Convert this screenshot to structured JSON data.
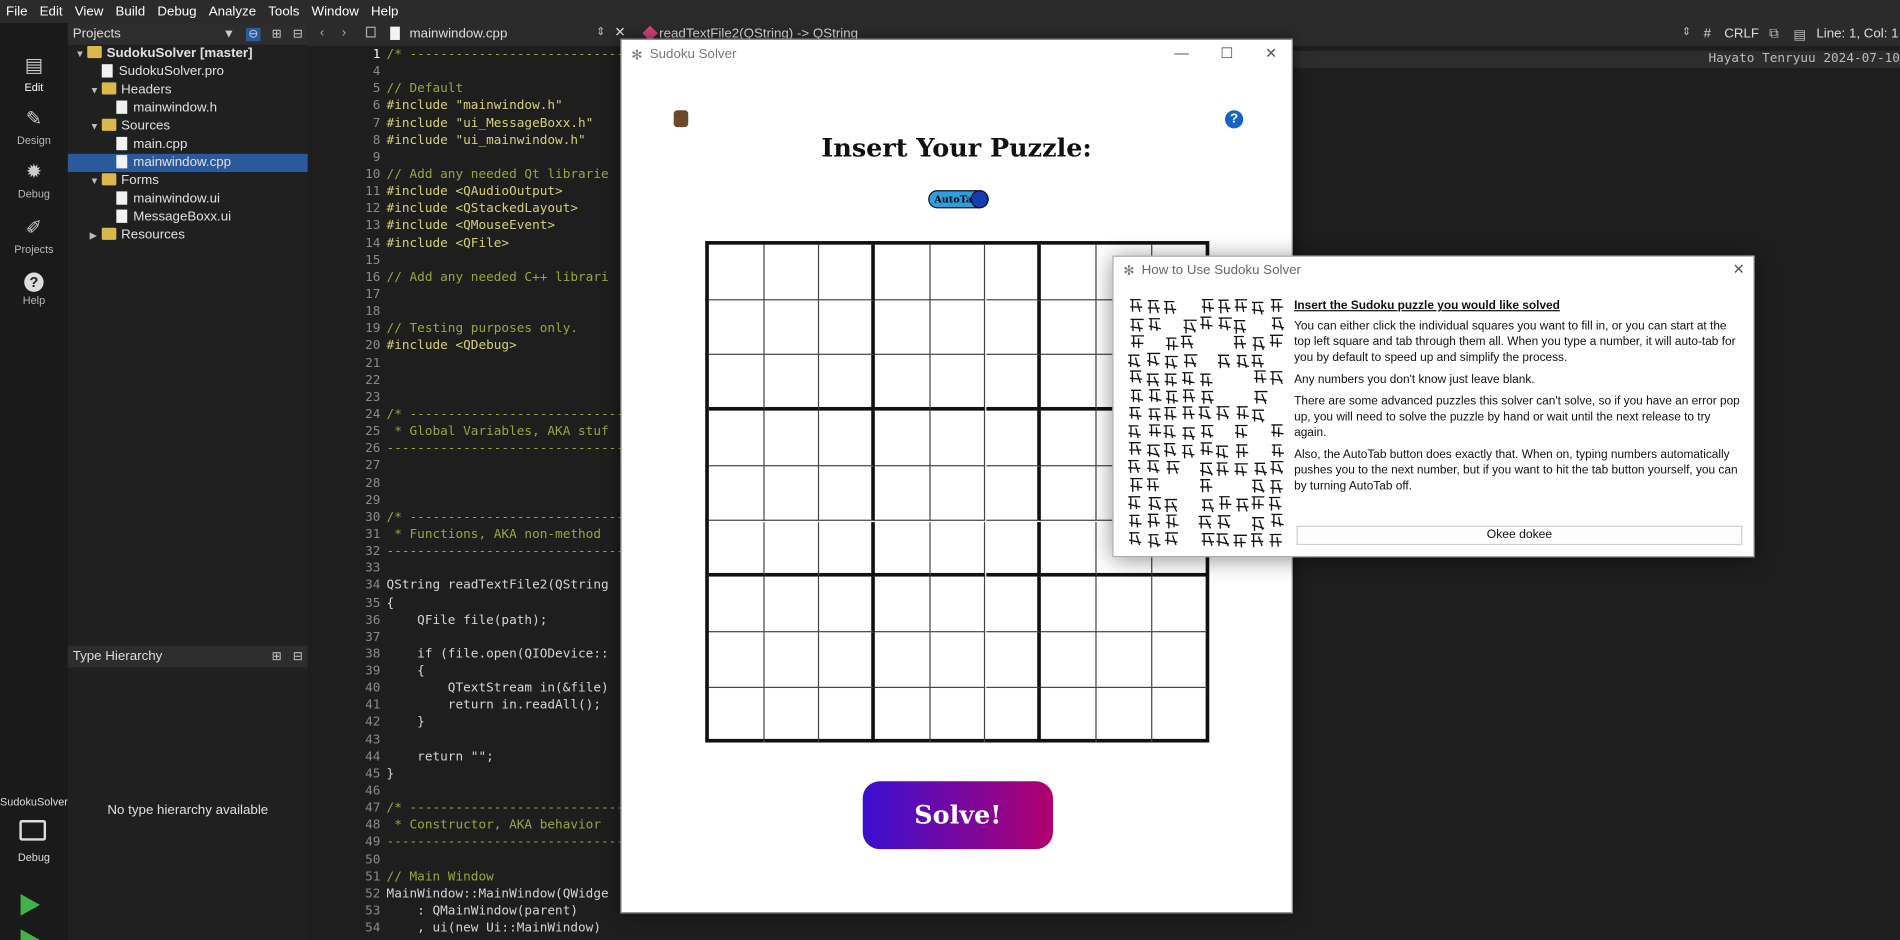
{
  "menu": [
    "File",
    "Edit",
    "View",
    "Build",
    "Debug",
    "Analyze",
    "Tools",
    "Window",
    "Help"
  ],
  "modes": [
    {
      "label": "Edit",
      "icon": "edit-icon"
    },
    {
      "label": "Design",
      "icon": "pencil-icon"
    },
    {
      "label": "Debug",
      "icon": "bug-icon"
    },
    {
      "label": "Projects",
      "icon": "wrench-icon"
    },
    {
      "label": "Help",
      "icon": "help-icon"
    }
  ],
  "kit": {
    "target": "SudokuSolver",
    "config": "Debug"
  },
  "projects": {
    "title": "Projects",
    "items": [
      {
        "label": "SudokuSolver [master]",
        "kind": "project",
        "depth": 0
      },
      {
        "label": "SudokuSolver.pro",
        "kind": "file",
        "depth": 1
      },
      {
        "label": "Headers",
        "kind": "folder",
        "depth": 1
      },
      {
        "label": "mainwindow.h",
        "kind": "file",
        "depth": 2
      },
      {
        "label": "Sources",
        "kind": "folder",
        "depth": 1
      },
      {
        "label": "main.cpp",
        "kind": "file",
        "depth": 2
      },
      {
        "label": "mainwindow.cpp",
        "kind": "file",
        "depth": 2,
        "selected": true
      },
      {
        "label": "Forms",
        "kind": "folder",
        "depth": 1
      },
      {
        "label": "mainwindow.ui",
        "kind": "file",
        "depth": 2
      },
      {
        "label": "MessageBoxx.ui",
        "kind": "file",
        "depth": 2
      },
      {
        "label": "Resources",
        "kind": "folder",
        "depth": 1
      }
    ]
  },
  "type_hierarchy": {
    "title": "Type Hierarchy",
    "empty": "No type hierarchy available"
  },
  "editor": {
    "file": "mainwindow.cpp",
    "symbol": "readTextFile2(QString) -> QString",
    "line_ending": "CRLF",
    "hash": "#",
    "position": "Line: 1, Col: 1",
    "author": "Hayato Tenryuu 2024-07-10",
    "lines": [
      {
        "n": "1",
        "t": "/* -----------------------------"
      },
      {
        "n": "4",
        "t": ""
      },
      {
        "n": "5",
        "t": "// Default"
      },
      {
        "n": "6",
        "t": "#include \"mainwindow.h\""
      },
      {
        "n": "7",
        "t": "#include \"ui_MessageBoxx.h\""
      },
      {
        "n": "8",
        "t": "#include \"ui_mainwindow.h\""
      },
      {
        "n": "9",
        "t": ""
      },
      {
        "n": "10",
        "t": "// Add any needed Qt librarie"
      },
      {
        "n": "11",
        "t": "#include <QAudioOutput>"
      },
      {
        "n": "12",
        "t": "#include <QStackedLayout>"
      },
      {
        "n": "13",
        "t": "#include <QMouseEvent>"
      },
      {
        "n": "14",
        "t": "#include <QFile>"
      },
      {
        "n": "15",
        "t": ""
      },
      {
        "n": "16",
        "t": "// Add any needed C++ librari"
      },
      {
        "n": "17",
        "t": ""
      },
      {
        "n": "18",
        "t": ""
      },
      {
        "n": "19",
        "t": "// Testing purposes only."
      },
      {
        "n": "20",
        "t": "#include <QDebug>"
      },
      {
        "n": "21",
        "t": ""
      },
      {
        "n": "22",
        "t": ""
      },
      {
        "n": "23",
        "t": ""
      },
      {
        "n": "24",
        "t": "/* -----------------------------"
      },
      {
        "n": "25",
        "t": " * Global Variables, AKA stuf"
      },
      {
        "n": "26",
        "t": "-------------------------------"
      },
      {
        "n": "27",
        "t": ""
      },
      {
        "n": "28",
        "t": ""
      },
      {
        "n": "29",
        "t": ""
      },
      {
        "n": "30",
        "t": "/* -----------------------------"
      },
      {
        "n": "31",
        "t": " * Functions, AKA non-method"
      },
      {
        "n": "32",
        "t": "-------------------------------"
      },
      {
        "n": "33",
        "t": ""
      },
      {
        "n": "34",
        "t": "QString readTextFile2(QString"
      },
      {
        "n": "35",
        "t": "{"
      },
      {
        "n": "36",
        "t": "    QFile file(path);"
      },
      {
        "n": "37",
        "t": ""
      },
      {
        "n": "38",
        "t": "    if (file.open(QIODevice::"
      },
      {
        "n": "39",
        "t": "    {"
      },
      {
        "n": "40",
        "t": "        QTextStream in(&file)"
      },
      {
        "n": "41",
        "t": "        return in.readAll();"
      },
      {
        "n": "42",
        "t": "    }"
      },
      {
        "n": "43",
        "t": ""
      },
      {
        "n": "44",
        "t": "    return \"\";"
      },
      {
        "n": "45",
        "t": "}"
      },
      {
        "n": "46",
        "t": ""
      },
      {
        "n": "47",
        "t": "/* -----------------------------"
      },
      {
        "n": "48",
        "t": " * Constructor, AKA behavior"
      },
      {
        "n": "49",
        "t": "-------------------------------"
      },
      {
        "n": "50",
        "t": ""
      },
      {
        "n": "51",
        "t": "// Main Window"
      },
      {
        "n": "52",
        "t": "MainWindow::MainWindow(QWidge"
      },
      {
        "n": "53",
        "t": "    : QMainWindow(parent)"
      },
      {
        "n": "54",
        "t": "    , ui(new Ui::MainWindow)"
      }
    ]
  },
  "sudoku": {
    "title": "Sudoku Solver",
    "heading": "Insert Your Puzzle:",
    "autotab": "AutoTab",
    "solve": "Solve!",
    "help_icon": "?"
  },
  "dialog": {
    "title": "How to Use Sudoku Solver",
    "heading": "Insert the Sudoku puzzle you would like solved",
    "paragraphs": [
      "You can either click the individual squares you want to fill in, or you can start at the top left square and tab through them all. When you type a number, it will auto-tab for you by default to speed up and simplify the process.",
      "Any numbers you don't know just leave blank.",
      "There are some advanced puzzles this solver can't solve, so if you have an error pop up, you will need to solve the puzzle by hand or wait until the next release to try again.",
      "Also, the AutoTab button does exactly that. When on, typing numbers automatically pushes you to the next number, but if you want to hit the tab button yourself, you can by turning AutoTab off."
    ],
    "ok": "Okee dokee"
  }
}
